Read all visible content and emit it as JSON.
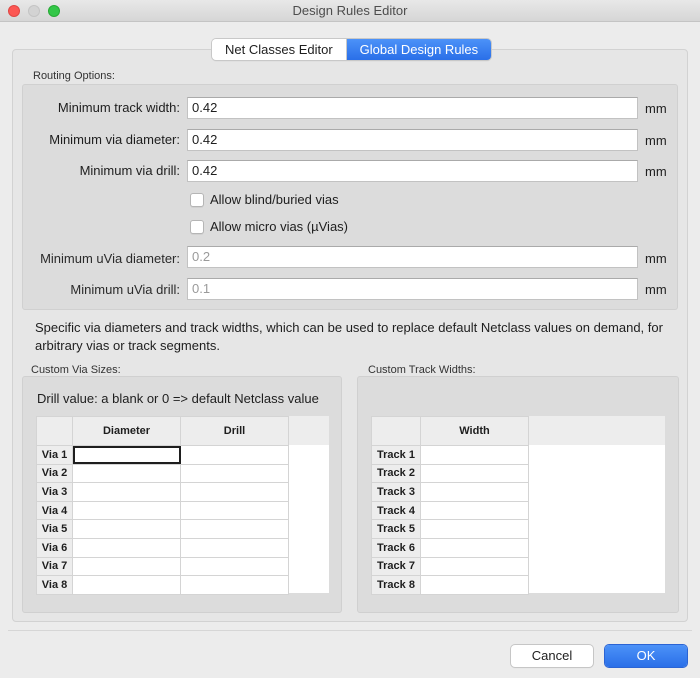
{
  "window": {
    "title": "Design Rules Editor"
  },
  "tabs": [
    {
      "label": "Net Classes Editor",
      "active": false
    },
    {
      "label": "Global Design Rules",
      "active": true
    }
  ],
  "routing": {
    "section_label": "Routing Options:",
    "min_track_width": {
      "label": "Minimum track width:",
      "value": "0.42",
      "unit": "mm"
    },
    "min_via_diameter": {
      "label": "Minimum via diameter:",
      "value": "0.42",
      "unit": "mm"
    },
    "min_via_drill": {
      "label": "Minimum via drill:",
      "value": "0.42",
      "unit": "mm"
    },
    "allow_blind_buried": {
      "label": "Allow blind/buried vias",
      "checked": false
    },
    "allow_micro_vias": {
      "label": "Allow micro vias (µVias)",
      "checked": false
    },
    "min_uvia_diameter": {
      "label": "Minimum uVia diameter:",
      "value": "0.2",
      "unit": "mm",
      "enabled": false
    },
    "min_uvia_drill": {
      "label": "Minimum uVia drill:",
      "value": "0.1",
      "unit": "mm",
      "enabled": false
    }
  },
  "info_text": "Specific via diameters and track widths, which can be used to replace default Netclass values on demand, for arbitrary vias or track segments.",
  "custom_via": {
    "section_label": "Custom Via Sizes:",
    "note": "Drill value: a blank or 0 => default Netclass value",
    "columns": [
      "Diameter",
      "Drill"
    ],
    "rows": [
      {
        "label": "Via 1",
        "diameter": "",
        "drill": ""
      },
      {
        "label": "Via 2",
        "diameter": "",
        "drill": ""
      },
      {
        "label": "Via 3",
        "diameter": "",
        "drill": ""
      },
      {
        "label": "Via 4",
        "diameter": "",
        "drill": ""
      },
      {
        "label": "Via 5",
        "diameter": "",
        "drill": ""
      },
      {
        "label": "Via 6",
        "diameter": "",
        "drill": ""
      },
      {
        "label": "Via 7",
        "diameter": "",
        "drill": ""
      },
      {
        "label": "Via 8",
        "diameter": "",
        "drill": ""
      }
    ]
  },
  "custom_track": {
    "section_label": "Custom Track Widths:",
    "columns": [
      "Width"
    ],
    "rows": [
      {
        "label": "Track 1",
        "width": ""
      },
      {
        "label": "Track 2",
        "width": ""
      },
      {
        "label": "Track 3",
        "width": ""
      },
      {
        "label": "Track 4",
        "width": ""
      },
      {
        "label": "Track 5",
        "width": ""
      },
      {
        "label": "Track 6",
        "width": ""
      },
      {
        "label": "Track 7",
        "width": ""
      },
      {
        "label": "Track 8",
        "width": ""
      }
    ]
  },
  "buttons": {
    "cancel": "Cancel",
    "ok": "OK"
  },
  "colors": {
    "accent": "#2a6fe8",
    "close": "#fc5753",
    "maximize": "#33c748"
  }
}
